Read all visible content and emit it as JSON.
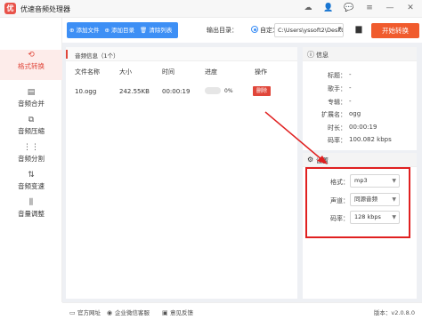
{
  "app": {
    "title": "优速音频处理器",
    "logo_text": "优"
  },
  "window_icons": [
    "cloud-icon",
    "user-icon",
    "chat-icon",
    "menu-icon",
    "minimize-icon",
    "close-icon"
  ],
  "window_glyphs": [
    "☁",
    "👤",
    "💬",
    "≡",
    "—",
    "✕"
  ],
  "sidebar": {
    "items": [
      {
        "label": "格式转换",
        "icon": "⟲",
        "active": true
      },
      {
        "label": "音频合并",
        "icon": "▤"
      },
      {
        "label": "音频压缩",
        "icon": "⧉"
      },
      {
        "label": "音频分割",
        "icon": "⋮⋮"
      },
      {
        "label": "音频变速",
        "icon": "⇅"
      },
      {
        "label": "音量调整",
        "icon": "⫼"
      }
    ]
  },
  "toolbar": {
    "add_file": "添加文件",
    "add_folder": "添加目录",
    "clear_list": "清除列表",
    "output_label": "输出目录：",
    "radio_label": "自定义",
    "output_path": "C:\\Users\\yssoft2\\Deskt",
    "start_button": "开始转换"
  },
  "file_panel": {
    "title": "音频信息（1个）",
    "headers": {
      "name": "文件名称",
      "size": "大小",
      "duration": "时间",
      "progress": "进度",
      "action": "操作"
    },
    "rows": [
      {
        "name": "10.ogg",
        "size": "242.55KB",
        "duration": "00:00:19",
        "progress_text": "0%",
        "progress": 0,
        "action": "删除"
      }
    ]
  },
  "info": {
    "title": "信息",
    "fields": [
      {
        "key": "标题：",
        "value": "-"
      },
      {
        "key": "歌手：",
        "value": "-"
      },
      {
        "key": "专辑：",
        "value": "-"
      },
      {
        "key": "扩展名：",
        "value": "ogg"
      },
      {
        "key": "时长：",
        "value": "00:00:19"
      },
      {
        "key": "码率：",
        "value": "100.082 kbps"
      }
    ]
  },
  "settings": {
    "title": "设置",
    "format_label": "格式：",
    "format_value": "mp3",
    "channel_label": "声道：",
    "channel_value": "同源音频",
    "bitrate_label": "码率：",
    "bitrate_value": "128 kbps"
  },
  "footer": {
    "website": "官方网址",
    "wechat": "企业微信客服",
    "feedback": "意见反馈",
    "version": "版本：v2.0.8.0"
  },
  "colors": {
    "accent": "#e0463a",
    "primary": "#3d8ff5",
    "start": "#f05b2d",
    "highlight": "#e02020"
  }
}
